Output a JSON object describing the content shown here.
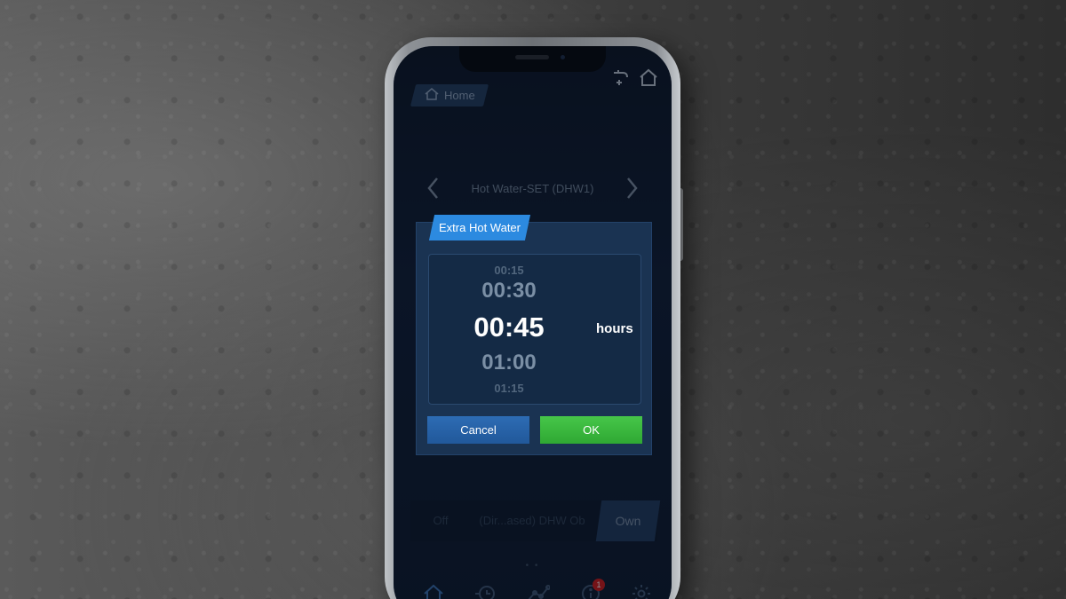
{
  "header": {
    "home_label": "Home"
  },
  "icons": {
    "tap": "faucet-add-icon",
    "home": "home-icon",
    "back": "chevron-left-icon",
    "forward": "chevron-right-icon",
    "nav_home": "home-icon",
    "nav_schedule": "clock-icon",
    "nav_stats": "chart-icon",
    "nav_info": "info-icon",
    "nav_settings": "gear-icon"
  },
  "navigation": {
    "title": "Hot Water-SET (DHW1)"
  },
  "dialog": {
    "title": "Extra Hot Water",
    "picker": {
      "values": [
        "00:15",
        "00:30",
        "00:45",
        "01:00",
        "01:15"
      ],
      "selected_value": "00:45",
      "unit": "hours"
    },
    "cancel_label": "Cancel",
    "ok_label": "OK"
  },
  "mode_selector": {
    "segments": [
      "Off",
      "(Dir...ased) DHW Ob",
      "Own"
    ],
    "active": "Own"
  },
  "bottom_nav": {
    "info_badge": "1"
  },
  "colors": {
    "accent_blue": "#2c8ae0",
    "ok_green": "#3ab53d",
    "cancel_blue": "#2762a8",
    "badge_red": "#d01a1a"
  }
}
